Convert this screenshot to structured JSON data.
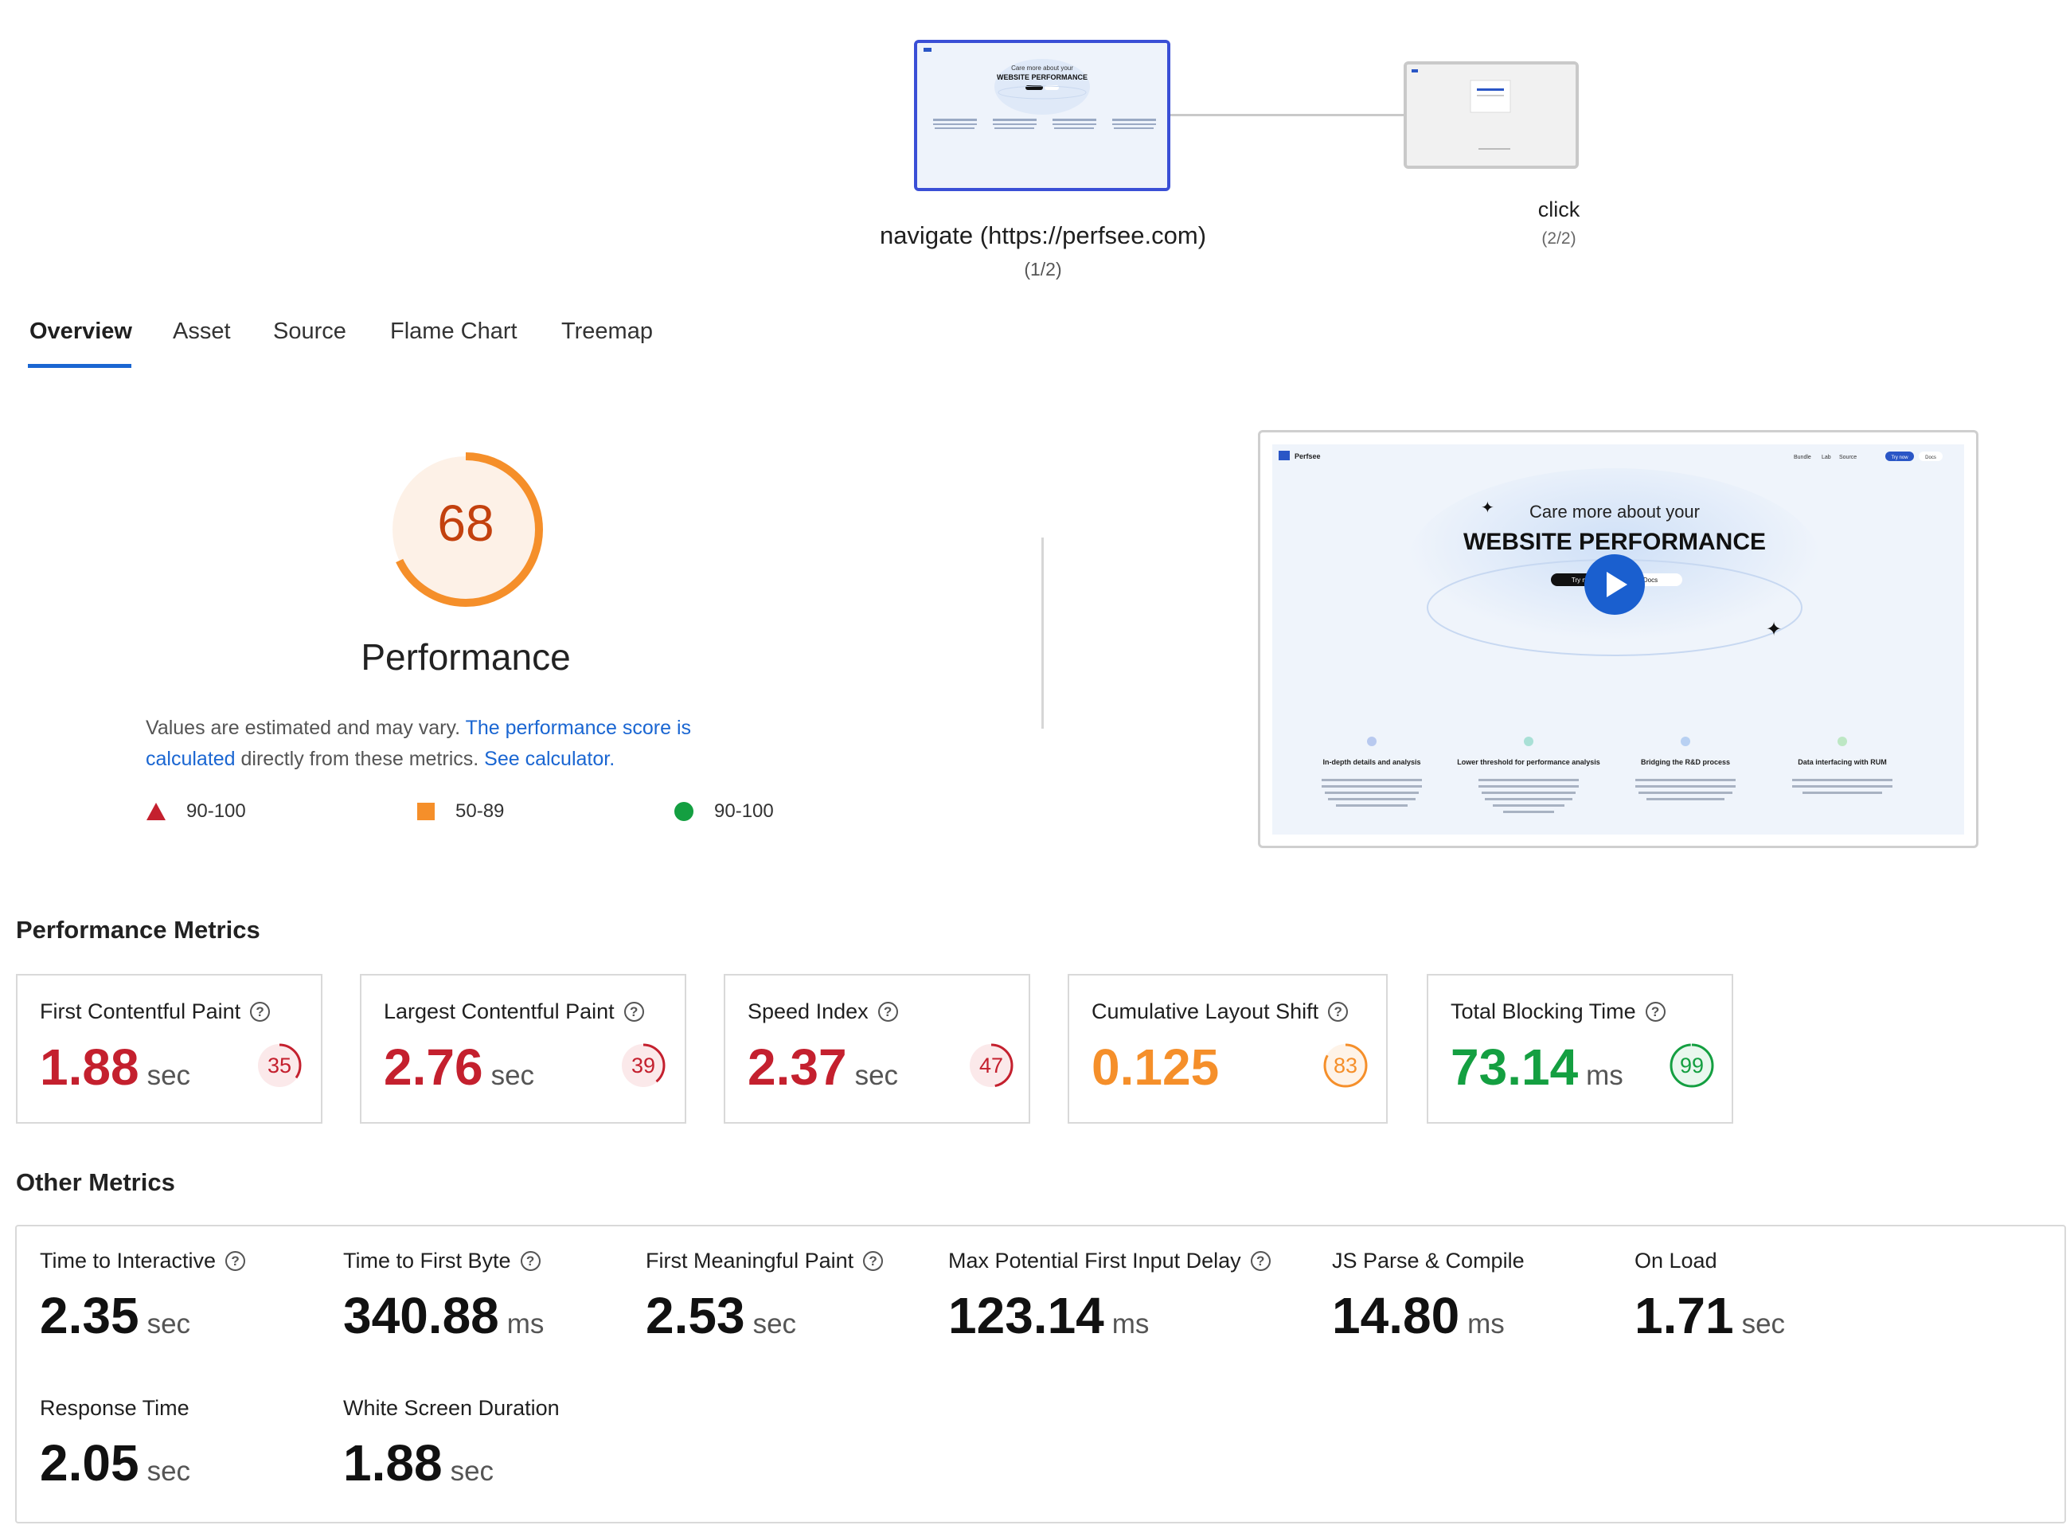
{
  "steps": [
    {
      "label": "navigate (https://perfsee.com)",
      "count": "(1/2)"
    },
    {
      "label": "click",
      "count": "(2/2)"
    }
  ],
  "thumb": {
    "brand": "Perfsee",
    "hero_line1": "Care more about your",
    "hero_line2": "WEBSITE PERFORMANCE",
    "nav": [
      "Bundle",
      "Lab",
      "Source",
      "Try now",
      "Docs"
    ],
    "cta_primary": "Try now",
    "cta_secondary": "Docs",
    "features": [
      {
        "title": "In-depth details and analysis",
        "body": "Pioneering analysis from web application's performance from perspectives, including packaged products, integrated test environments, and back to source code."
      },
      {
        "title": "Lower threshold for performance analysis",
        "body": "Provide professional optimization advice based on multiple perspectives. Even newcomers with little experience in performance optimization can follow the diagram."
      },
      {
        "title": "Bridging the R&D process",
        "body": "From development to deployment, the Perfsee toolset has been permeated through the development process, tracking performance changes between releases in real time."
      },
      {
        "title": "Data interfacing with RUM",
        "body": "Based on RUM data, gives better guidance on performance analysis and comparison with the online version."
      }
    ]
  },
  "tabs": [
    "Overview",
    "Asset",
    "Source",
    "Flame Chart",
    "Treemap"
  ],
  "score": {
    "value": "68",
    "fraction": 0.68,
    "title": "Performance",
    "color": "#f58f2a"
  },
  "description": {
    "text1": "Values are estimated and may vary. ",
    "link1": "The performance score is calculated",
    "text2": " directly from these metrics. ",
    "link2": "See calculator."
  },
  "legend": [
    {
      "shape": "triangle",
      "color": "#c4202e",
      "range": "90-100"
    },
    {
      "shape": "square",
      "color": "#f58f2a",
      "range": "50-89"
    },
    {
      "shape": "circle",
      "color": "#149f41",
      "range": "90-100"
    }
  ],
  "performance_metrics_title": "Performance Metrics",
  "performance_metrics": [
    {
      "label": "First Contentful Paint",
      "value": "1.88",
      "unit": "sec",
      "score": "35",
      "status": "red"
    },
    {
      "label": "Largest Contentful Paint",
      "value": "2.76",
      "unit": "sec",
      "score": "39",
      "status": "red"
    },
    {
      "label": "Speed Index",
      "value": "2.37",
      "unit": "sec",
      "score": "47",
      "status": "red"
    },
    {
      "label": "Cumulative Layout Shift",
      "value": "0.125",
      "unit": "",
      "score": "83",
      "status": "orange"
    },
    {
      "label": "Total Blocking Time",
      "value": "73.14",
      "unit": "ms",
      "score": "99",
      "status": "green"
    }
  ],
  "other_metrics_title": "Other Metrics",
  "other_metrics": [
    {
      "label": "Time to Interactive",
      "value": "2.35",
      "unit": "sec",
      "help": true
    },
    {
      "label": "Time to First Byte",
      "value": "340.88",
      "unit": "ms",
      "help": true
    },
    {
      "label": "First Meaningful Paint",
      "value": "2.53",
      "unit": "sec",
      "help": true
    },
    {
      "label": "Max Potential First Input Delay",
      "value": "123.14",
      "unit": "ms",
      "help": true
    },
    {
      "label": "JS Parse & Compile",
      "value": "14.80",
      "unit": "ms",
      "help": false
    },
    {
      "label": "On Load",
      "value": "1.71",
      "unit": "sec",
      "help": false
    },
    {
      "label": "Response Time",
      "value": "2.05",
      "unit": "sec",
      "help": false
    },
    {
      "label": "White Screen Duration",
      "value": "1.88",
      "unit": "sec",
      "help": false
    }
  ],
  "colors": {
    "accent": "#1a66d2",
    "red": "#c4202e",
    "orange": "#f58f2a",
    "green": "#149f41",
    "step_active": "#3a4fd6"
  }
}
